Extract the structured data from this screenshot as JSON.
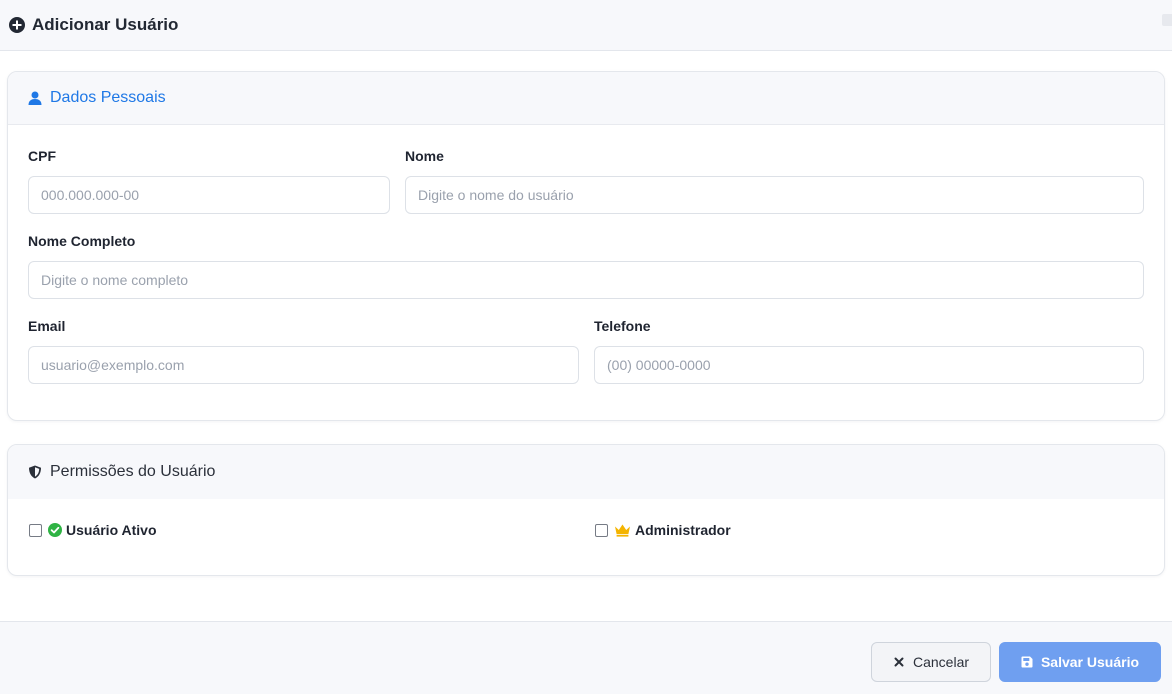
{
  "header": {
    "title": "Adicionar Usuário",
    "icon": "plus-circle-icon"
  },
  "personal": {
    "title": "Dados Pessoais",
    "icon": "user-icon",
    "accent": "#1f78e6",
    "fields": {
      "cpf": {
        "label": "CPF",
        "placeholder": "000.000.000-00",
        "value": ""
      },
      "nome": {
        "label": "Nome",
        "placeholder": "Digite o nome do usuário",
        "value": ""
      },
      "nome_completo": {
        "label": "Nome Completo",
        "placeholder": "Digite o nome completo",
        "value": ""
      },
      "email": {
        "label": "Email",
        "placeholder": "usuario@exemplo.com",
        "value": ""
      },
      "telefone": {
        "label": "Telefone",
        "placeholder": "(00) 00000-0000",
        "value": ""
      }
    }
  },
  "permissions": {
    "title": "Permissões do Usuário",
    "icon": "shield-icon",
    "options": {
      "ativo": {
        "label": "Usuário Ativo",
        "icon": "check-circle-icon",
        "icon_color": "#2fb344",
        "checked": false
      },
      "admin": {
        "label": "Administrador",
        "icon": "crown-icon",
        "icon_color": "#f4b400",
        "checked": false
      }
    }
  },
  "footer": {
    "cancel_label": "Cancelar",
    "cancel_icon": "close-icon",
    "save_label": "Salvar Usuário",
    "save_icon": "save-icon",
    "save_color": "#6f9ff0"
  }
}
